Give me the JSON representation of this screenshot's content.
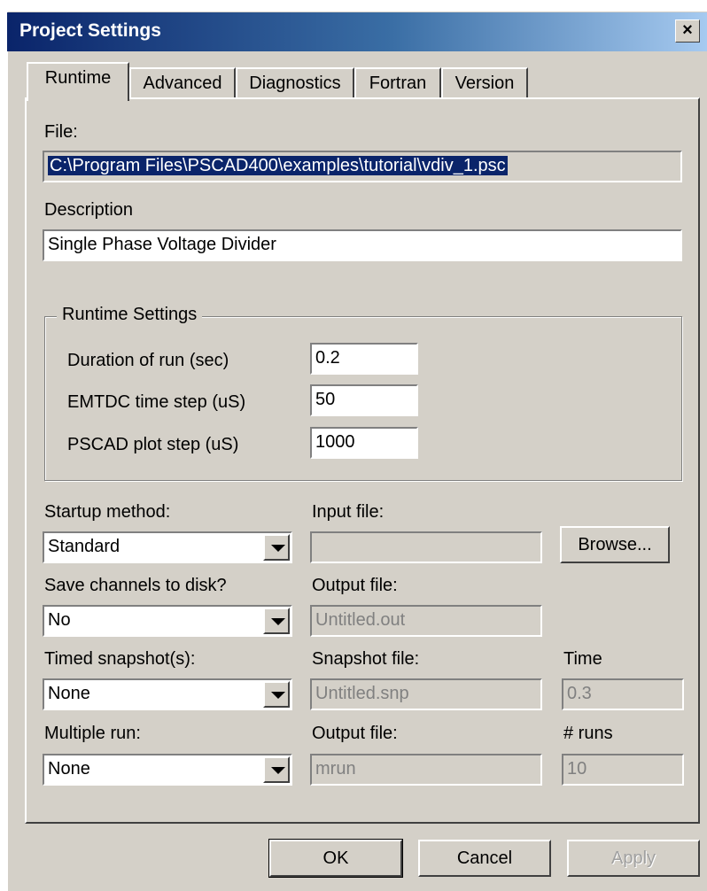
{
  "window": {
    "title": "Project Settings",
    "close_glyph": "×"
  },
  "tabs": [
    "Runtime",
    "Advanced",
    "Diagnostics",
    "Fortran",
    "Version"
  ],
  "file": {
    "label": "File:",
    "value": "C:\\Program Files\\PSCAD400\\examples\\tutorial\\vdiv_1.psc"
  },
  "description": {
    "label": "Description",
    "value": "Single Phase Voltage Divider"
  },
  "runtime_settings": {
    "legend": "Runtime Settings",
    "duration_label": "Duration of run (sec)",
    "duration_value": "0.2",
    "timestep_label": "EMTDC time step (uS)",
    "timestep_value": "50",
    "plotstep_label": "PSCAD plot step (uS)",
    "plotstep_value": "1000"
  },
  "startup": {
    "label": "Startup method:",
    "value": "Standard",
    "input_label": "Input file:",
    "input_value": "",
    "browse": "Browse..."
  },
  "save_channels": {
    "label": "Save channels to disk?",
    "value": "No",
    "output_label": "Output file:",
    "output_value": "Untitled.out"
  },
  "snapshot": {
    "label": "Timed snapshot(s):",
    "value": "None",
    "file_label": "Snapshot file:",
    "file_value": "Untitled.snp",
    "time_label": "Time",
    "time_value": "0.3"
  },
  "multiple_run": {
    "label": "Multiple run:",
    "value": "None",
    "output_label": "Output file:",
    "output_value": "mrun",
    "runs_label": "# runs",
    "runs_value": "10"
  },
  "buttons": {
    "ok": "OK",
    "cancel": "Cancel",
    "apply": "Apply"
  },
  "colors": {
    "titlebar_start": "#0a246a",
    "titlebar_end": "#a6caf0",
    "face": "#d4d0c8",
    "selection": "#0a246a"
  }
}
